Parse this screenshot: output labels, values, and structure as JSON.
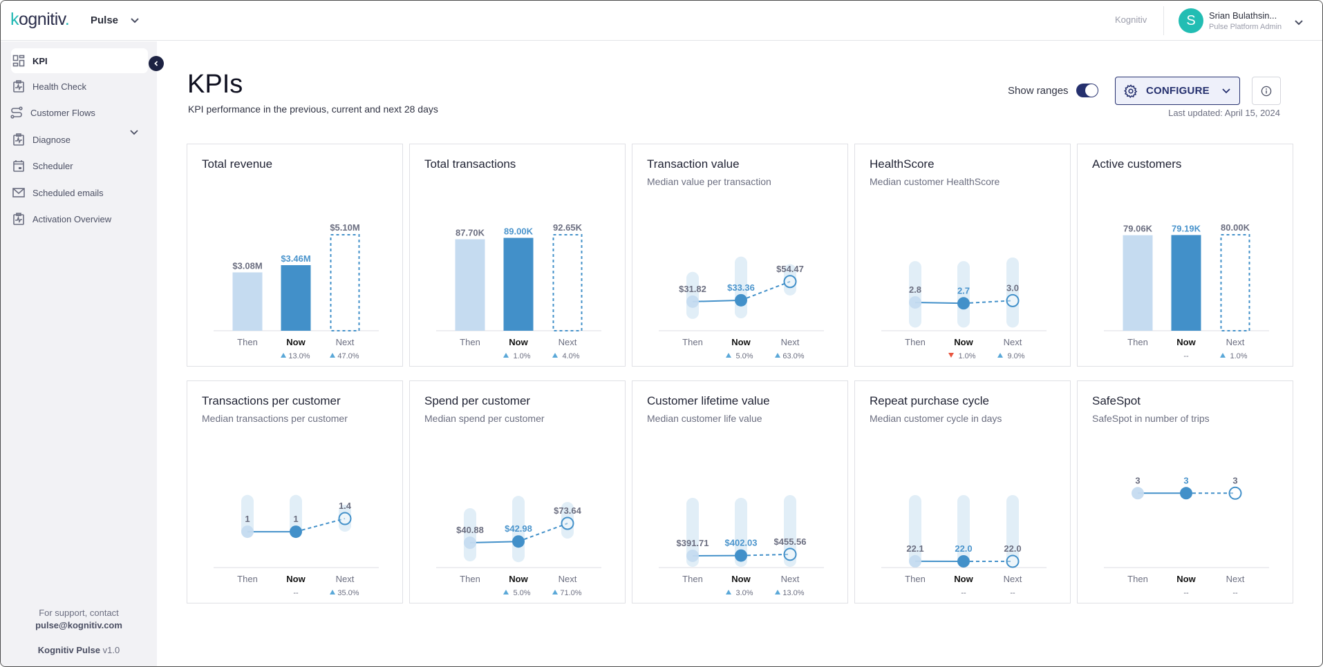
{
  "header": {
    "logo": {
      "prefix": "k",
      "rest": "ognitiv",
      "dot": "."
    },
    "product": "Pulse",
    "org_link": "Kognitiv",
    "user": {
      "initial": "S",
      "name": "Srian Bulathsin...",
      "role": "Pulse Platform Admin"
    }
  },
  "sidebar": {
    "items": [
      {
        "label": "KPI",
        "icon": "dashboard-icon",
        "active": true
      },
      {
        "label": "Health Check",
        "icon": "clipboard-pulse-icon",
        "expandable": true
      },
      {
        "label": "Customer Flows",
        "icon": "route-icon"
      },
      {
        "label": "Diagnose",
        "icon": "clipboard-pulse-icon"
      },
      {
        "label": "Scheduler",
        "icon": "calendar-icon"
      },
      {
        "label": "Scheduled emails",
        "icon": "mail-icon"
      },
      {
        "label": "Activation Overview",
        "icon": "clipboard-pulse-icon"
      }
    ],
    "support_text": "For support, contact",
    "support_email": "pulse@kognitiv.com",
    "version_name": "Kognitiv Pulse",
    "version_number": "v1.0"
  },
  "main": {
    "title": "KPIs",
    "subtitle": "KPI performance in the previous, current and next 28 days",
    "show_ranges_label": "Show ranges",
    "show_ranges_on": true,
    "configure_label": "CONFIGURE",
    "last_updated": "Last updated: April 15, 2024"
  },
  "colors": {
    "then": "#c5dbf0",
    "now": "#4290c9",
    "range": "#e1eef7",
    "up": "#5aa8d8",
    "down": "#e8553f",
    "navy": "#25306e"
  },
  "chart_data": [
    {
      "id": "total-revenue",
      "type": "bar",
      "title": "Total revenue",
      "subtitle": "",
      "categories": [
        "Then",
        "Now",
        "Next"
      ],
      "values": [
        3.08,
        3.46,
        5.1
      ],
      "unit": "$M",
      "labels": [
        "$3.08M",
        "$3.46M",
        "$5.10M"
      ],
      "changes": [
        null,
        {
          "dir": "up",
          "text": "13.0%"
        },
        {
          "dir": "up",
          "text": "47.0%"
        }
      ],
      "ylim": [
        0,
        5.1
      ]
    },
    {
      "id": "total-transactions",
      "type": "bar",
      "title": "Total transactions",
      "subtitle": "",
      "categories": [
        "Then",
        "Now",
        "Next"
      ],
      "values": [
        87.7,
        89.0,
        92.65
      ],
      "unit": "K",
      "labels": [
        "87.70K",
        "89.00K",
        "92.65K"
      ],
      "changes": [
        null,
        {
          "dir": "up",
          "text": "1.0%"
        },
        {
          "dir": "up",
          "text": "4.0%"
        }
      ],
      "ylim": [
        0,
        92.65
      ]
    },
    {
      "id": "transaction-value",
      "type": "line",
      "title": "Transaction value",
      "subtitle": "Median value per transaction",
      "categories": [
        "Then",
        "Now",
        "Next"
      ],
      "values": [
        31.82,
        33.36,
        54.47
      ],
      "labels": [
        "$31.82",
        "$33.36",
        "$54.47"
      ],
      "ranges": [
        [
          12.3,
          65.4
        ],
        [
          13.0,
          82.6
        ],
        [
          38.8,
          74.0
        ]
      ],
      "changes": [
        null,
        {
          "dir": "up",
          "text": "5.0%"
        },
        {
          "dir": "up",
          "text": "63.0%"
        }
      ],
      "ylim": [
        -1,
        108
      ]
    },
    {
      "id": "healthscore",
      "type": "line",
      "title": "HealthScore",
      "subtitle": "Median customer HealthScore",
      "categories": [
        "Then",
        "Now",
        "Next"
      ],
      "values": [
        2.8,
        2.7,
        3.0
      ],
      "labels": [
        "2.8",
        "2.7",
        "3.0"
      ],
      "ranges": [
        [
          0.0,
          7.4
        ],
        [
          0.0,
          7.4
        ],
        [
          0.0,
          7.8
        ]
      ],
      "changes": [
        null,
        {
          "dir": "down",
          "text": "1.0%"
        },
        {
          "dir": "up",
          "text": "9.0%"
        }
      ],
      "ylim": [
        -0.35,
        10.4
      ]
    },
    {
      "id": "active-customers",
      "type": "bar",
      "title": "Active customers",
      "subtitle": "",
      "categories": [
        "Then",
        "Now",
        "Next"
      ],
      "values": [
        79.06,
        79.19,
        80.0
      ],
      "unit": "K",
      "labels": [
        "79.06K",
        "79.19K",
        "80.00K"
      ],
      "changes": [
        null,
        {
          "dir": "none",
          "text": "--"
        },
        {
          "dir": "up",
          "text": "1.0%"
        }
      ],
      "ylim": [
        0,
        80.0
      ]
    },
    {
      "id": "transactions-per-customer",
      "type": "line",
      "title": "Transactions per customer",
      "subtitle": "Median transactions per customer",
      "categories": [
        "Then",
        "Now",
        "Next"
      ],
      "values": [
        1,
        1,
        1.4
      ],
      "labels": [
        "1",
        "1",
        "1.4"
      ],
      "ranges": [
        [
          0.85,
          2.12
        ],
        [
          0.85,
          2.12
        ],
        [
          1.0,
          1.82
        ]
      ],
      "now_label_muted": true,
      "changes": [
        null,
        {
          "dir": "none",
          "text": "--"
        },
        {
          "dir": "up",
          "text": "35.0%"
        }
      ],
      "ylim": [
        -0.09,
        2.85
      ]
    },
    {
      "id": "spend-per-customer",
      "type": "line",
      "title": "Spend per customer",
      "subtitle": "Median spend per customer",
      "categories": [
        "Then",
        "Now",
        "Next"
      ],
      "values": [
        40.88,
        42.98,
        73.64
      ],
      "labels": [
        "$40.88",
        "$42.98",
        "$73.64"
      ],
      "ranges": [
        [
          9.3,
          99.4
        ],
        [
          7.9,
          120.2
        ],
        [
          47.9,
          109.9
        ]
      ],
      "changes": [
        null,
        {
          "dir": "up",
          "text": "5.0%"
        },
        {
          "dir": "up",
          "text": "71.0%"
        }
      ],
      "ylim": [
        -1.2,
        162.5
      ]
    },
    {
      "id": "customer-lifetime-value",
      "type": "line",
      "title": "Customer lifetime value",
      "subtitle": "Median customer life value",
      "categories": [
        "Then",
        "Now",
        "Next"
      ],
      "values": [
        391.71,
        402.03,
        455.56
      ],
      "labels": [
        "$391.71",
        "$402.03",
        "$455.56"
      ],
      "ranges": [
        [
          -90,
          2910
        ],
        [
          -90,
          2910
        ],
        [
          -90,
          3030
        ]
      ],
      "changes": [
        null,
        {
          "dir": "up",
          "text": "3.0%"
        },
        {
          "dir": "up",
          "text": "13.0%"
        }
      ],
      "ylim": [
        -120,
        4080
      ]
    },
    {
      "id": "repeat-purchase-cycle",
      "type": "line",
      "title": "Repeat purchase cycle",
      "subtitle": "Median customer cycle in days",
      "categories": [
        "Then",
        "Now",
        "Next"
      ],
      "values": [
        22.1,
        22.0,
        22.0
      ],
      "labels": [
        "22.1",
        "22.0",
        "22.0"
      ],
      "ranges": [
        [
          2,
          255
        ],
        [
          2,
          255
        ],
        [
          2,
          255
        ]
      ],
      "changes": [
        null,
        {
          "dir": "none",
          "text": "--"
        },
        {
          "dir": "none",
          "text": "--"
        }
      ],
      "ylim": [
        0,
        340
      ]
    },
    {
      "id": "safespot",
      "type": "line",
      "title": "SafeSpot",
      "subtitle": "SafeSpot in number of trips",
      "categories": [
        "Then",
        "Now",
        "Next"
      ],
      "values": [
        3,
        3,
        3
      ],
      "labels": [
        "3",
        "3",
        "3"
      ],
      "ranges": null,
      "changes": [
        null,
        {
          "dir": "none",
          "text": "--"
        },
        {
          "dir": "none",
          "text": "--"
        }
      ],
      "ylim": [
        0,
        3.9
      ]
    }
  ]
}
